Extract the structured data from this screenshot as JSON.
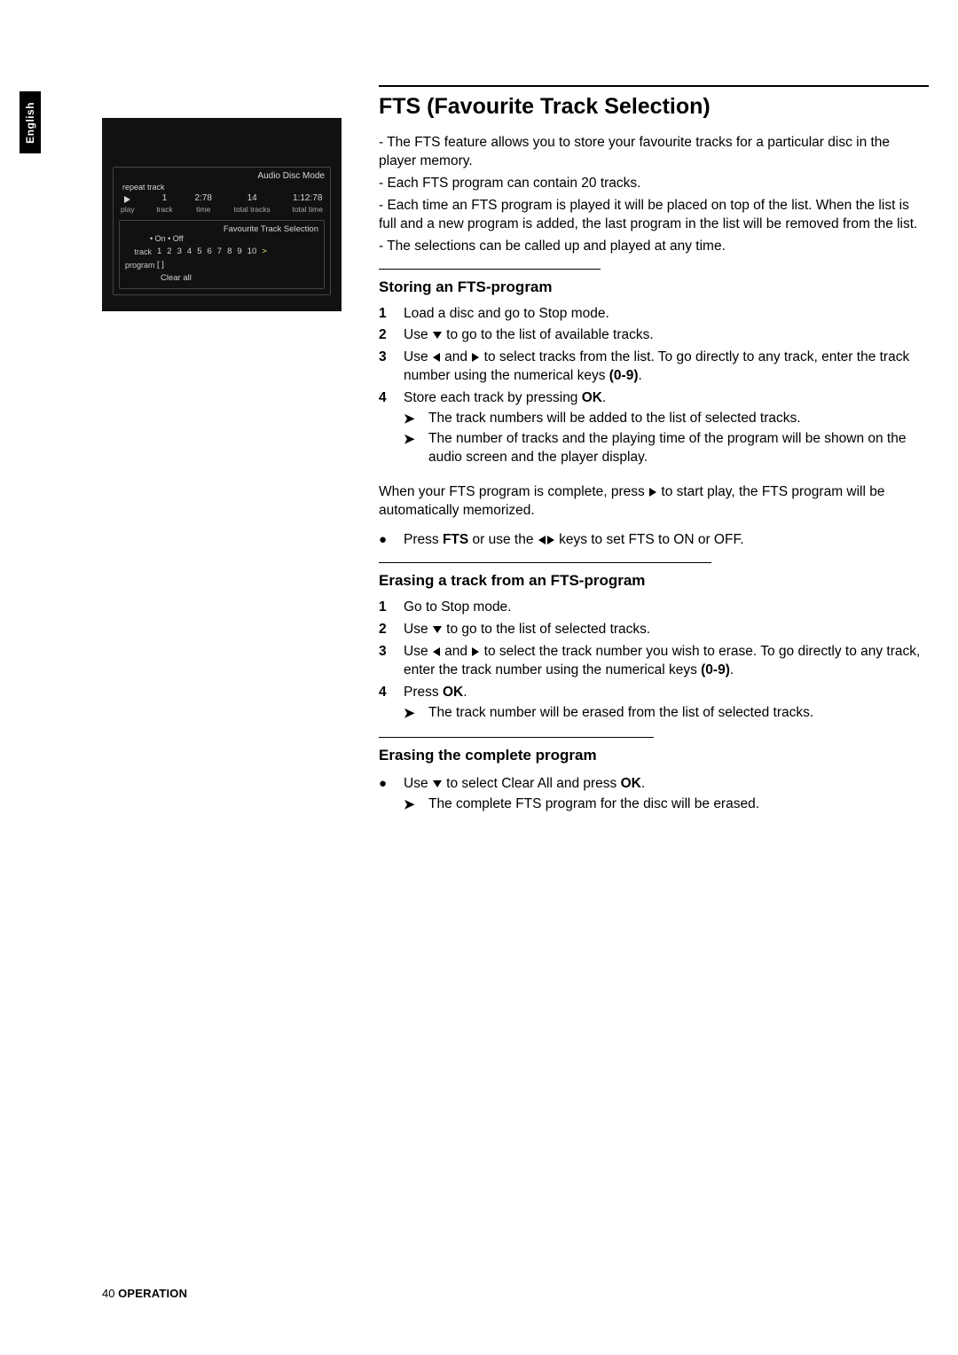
{
  "sideTab": "English",
  "display": {
    "modeTitle": "Audio Disc Mode",
    "repeat": "repeat track",
    "status": {
      "playLabel": "play",
      "track": "1",
      "trackLabel": "track",
      "time": "2:78",
      "timeLabel": "time",
      "totalTracks": "14",
      "totalTracksLabel": "total tracks",
      "totalTime": "1:12:78",
      "totalTimeLabel": "total time"
    },
    "fts": {
      "title": "Favourite Track Selection",
      "onoff": "• On  • Off",
      "trackLabel": "track",
      "tracks": [
        "1",
        "2",
        "3",
        "4",
        "5",
        "6",
        "7",
        "8",
        "9",
        "10"
      ],
      "gt": ">",
      "programLabel": "program",
      "programVal": "[ ]",
      "clear": "Clear all"
    }
  },
  "title": "FTS (Favourite Track Selection)",
  "intro": [
    "- The FTS feature allows you to store your favourite tracks for a particular disc in the player memory.",
    "- Each FTS program can contain 20 tracks.",
    "- Each time an FTS program is played it will be placed on top of the list. When the list is full and a new program is added, the last program in the list will be removed from the list.",
    "- The selections can be called up and played at any time."
  ],
  "storing": {
    "heading": "Storing an FTS-program",
    "s1": "Load a disc and go to Stop mode.",
    "s2a": "Use ",
    "s2b": " to go to the list of available tracks.",
    "s3a": "Use ",
    "s3b": " and ",
    "s3c": " to select tracks from the list. To go directly to any track, enter the track number using the numerical keys ",
    "s3d": "(0-9)",
    "s3e": ".",
    "s4a": "Store each track by pressing ",
    "s4b": "OK",
    "s4c": ".",
    "s4sub1": "The track numbers will be added to the list of selected tracks.",
    "s4sub2": "The number of tracks and the playing time of the program will be shown on the audio screen and the player display.",
    "afterA": "When your FTS program is complete, press ",
    "afterB": " to start play, the FTS program will be automatically memorized.",
    "bulletA": "Press ",
    "bulletB": "FTS",
    "bulletC": " or use the ",
    "bulletD": " keys to set FTS to ON or OFF."
  },
  "erasing": {
    "heading": "Erasing a track from an FTS-program",
    "s1": "Go to Stop mode.",
    "s2a": "Use ",
    "s2b": " to go to the list of selected tracks.",
    "s3a": "Use ",
    "s3b": " and ",
    "s3c": " to select the track number you wish to erase. To go directly to any track, enter the track number using the numerical keys ",
    "s3d": "(0-9)",
    "s3e": ".",
    "s4a": "Press ",
    "s4b": "OK",
    "s4c": ".",
    "s4sub": "The track number will be erased from the list of selected tracks."
  },
  "erasingAll": {
    "heading": "Erasing the complete program",
    "bulletA": "Use ",
    "bulletB": " to select Clear All and press ",
    "bulletC": "OK",
    "bulletD": ".",
    "sub": "The complete FTS program for the disc will be erased."
  },
  "footerPage": "40",
  "footerSection": "OPERATION"
}
